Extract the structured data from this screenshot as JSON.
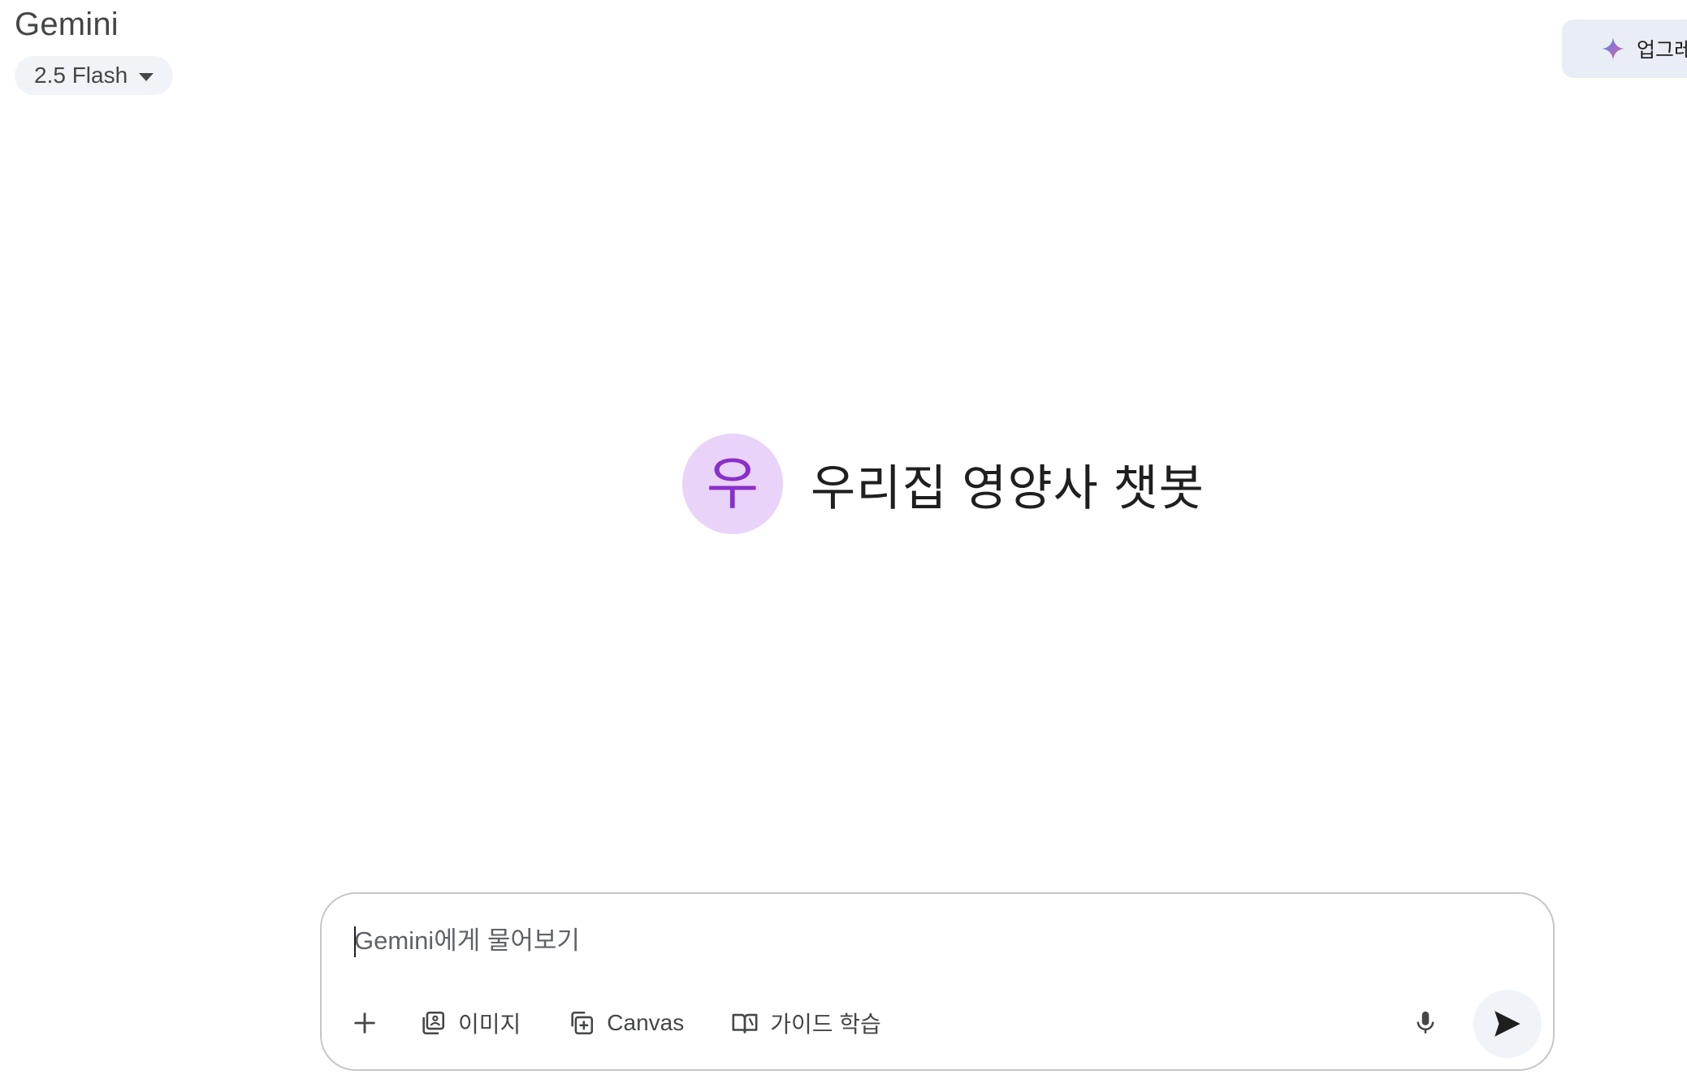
{
  "app": {
    "title": "Gemini"
  },
  "model_selector": {
    "label": "2.5 Flash",
    "icon": "caret-down-icon"
  },
  "upgrade": {
    "label": "업그레이드",
    "icon": "gemini-spark-icon"
  },
  "gem": {
    "avatar_letter": "우",
    "name": "우리집 영양사 챗봇",
    "avatar_color": "#e9d3f8",
    "letter_color": "#8a2fc9"
  },
  "composer": {
    "placeholder": "Gemini에게 물어보기",
    "tools": [
      {
        "label": "이미지",
        "icon": "image-icon"
      },
      {
        "label": "Canvas",
        "icon": "canvas-icon"
      },
      {
        "label": "가이드 학습",
        "icon": "book-icon"
      }
    ],
    "add_icon": "plus-icon",
    "mic_icon": "mic-icon",
    "send_icon": "send-icon"
  }
}
